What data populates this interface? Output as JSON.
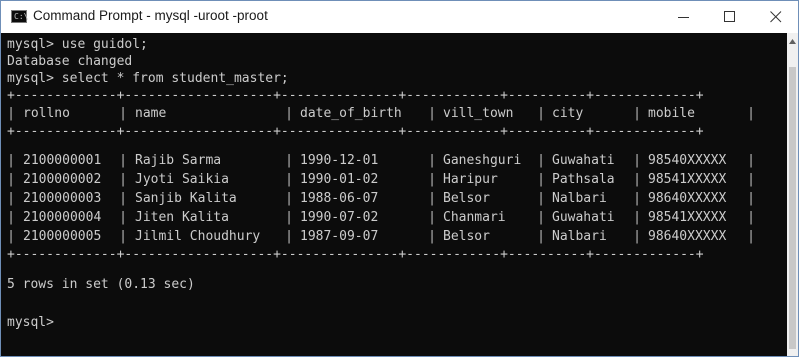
{
  "window": {
    "title": "Command Prompt - mysql  -uroot -proot",
    "icon": "command-prompt-icon",
    "controls": [
      "minimize-icon",
      "maximize-icon",
      "close-icon"
    ]
  },
  "console": {
    "lines": [
      "mysql> use guidol;",
      "Database changed",
      "mysql> select * from student_master;"
    ],
    "table": {
      "border": "+-------------+-------------------+---------------+------------+----------+-------------+",
      "columns": [
        "rollno",
        "name",
        "date_of_birth",
        "vill_town",
        "city",
        "mobile"
      ],
      "rows": [
        [
          "2100000001",
          "Rajib Sarma",
          "1990-12-01",
          "Ganeshguri",
          "Guwahati",
          "98540XXXXX"
        ],
        [
          "2100000002",
          "Jyoti Saikia",
          "1990-01-02",
          "Haripur",
          "Pathsala",
          "98541XXXXX"
        ],
        [
          "2100000003",
          "Sanjib Kalita",
          "1988-06-07",
          "Belsor",
          "Nalbari",
          "98640XXXXX"
        ],
        [
          "2100000004",
          "Jiten Kalita",
          "1990-07-02",
          "Chanmari",
          "Guwahati",
          "98541XXXXX"
        ],
        [
          "2100000005",
          "Jilmil Choudhury",
          "1987-09-07",
          "Belsor",
          "Nalbari",
          "98640XXXXX"
        ]
      ]
    },
    "summary": "5 rows in set (0.13 sec)",
    "prompt": "mysql>"
  },
  "colors": {
    "background": "#0c0c0c",
    "text": "#cccccc",
    "titlebar": "#ffffff"
  }
}
